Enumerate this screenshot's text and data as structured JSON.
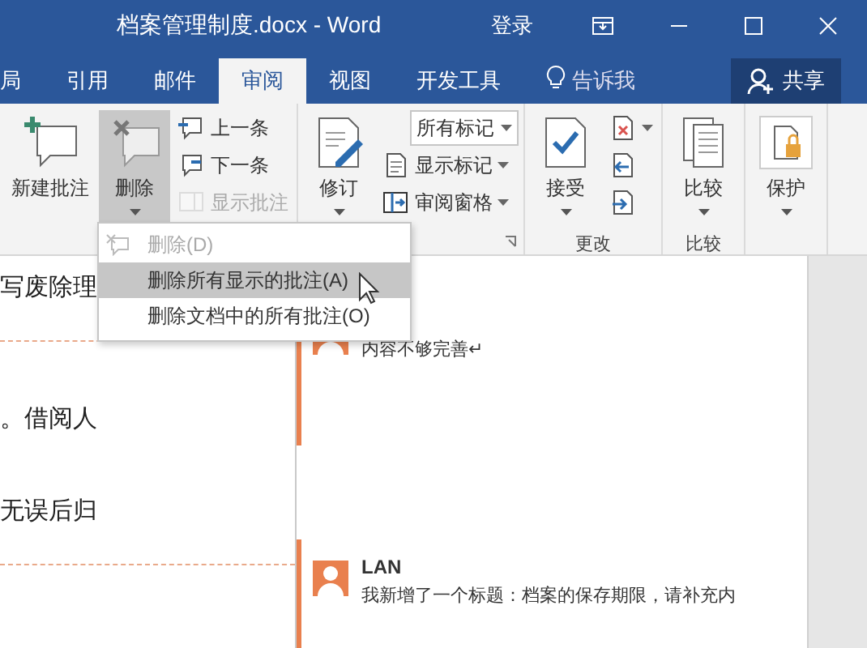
{
  "title_bar": {
    "title": "档案管理制度.docx - Word",
    "sign_in": "登录"
  },
  "tabs": [
    {
      "label": "局",
      "selected": false
    },
    {
      "label": "引用",
      "selected": false
    },
    {
      "label": "邮件",
      "selected": false
    },
    {
      "label": "审阅",
      "selected": true
    },
    {
      "label": "视图",
      "selected": false
    },
    {
      "label": "开发工具",
      "selected": false
    }
  ],
  "tell_me": "告诉我",
  "share_button": "共享",
  "ribbon": {
    "groups": [
      {
        "items": [
          {
            "kind": "large",
            "label": "新建批注",
            "pressed": false,
            "caret": false
          },
          {
            "kind": "large",
            "label": "删除",
            "pressed": true,
            "caret": true
          },
          {
            "kind": "stack",
            "rows": [
              {
                "kind": "small",
                "label": "上一条",
                "disabled": false,
                "caret": false
              },
              {
                "kind": "small",
                "label": "下一条",
                "disabled": false,
                "caret": false
              },
              {
                "kind": "small",
                "label": "显示批注",
                "disabled": true,
                "caret": false
              }
            ]
          }
        ]
      },
      {
        "items": [
          {
            "kind": "large",
            "label": "修订",
            "pressed": false,
            "caret": true
          },
          {
            "kind": "stack",
            "rows": [
              {
                "kind": "dropdown",
                "label": "所有标记",
                "caret": true
              },
              {
                "kind": "small",
                "label": "显示标记",
                "disabled": false,
                "caret": true
              },
              {
                "kind": "small",
                "label": "审阅窗格",
                "disabled": false,
                "caret": true
              }
            ]
          }
        ],
        "launcher": true
      },
      {
        "label": "更改",
        "items": [
          {
            "kind": "large",
            "label": "接受",
            "pressed": false,
            "caret": true
          },
          {
            "kind": "stack",
            "rows": [
              {
                "kind": "icon",
                "disabled": false,
                "caret": true
              },
              {
                "kind": "icon",
                "disabled": false,
                "caret": false
              },
              {
                "kind": "icon",
                "disabled": false,
                "caret": false
              }
            ]
          }
        ]
      },
      {
        "label": "比较",
        "items": [
          {
            "kind": "large",
            "label": "比较",
            "pressed": false,
            "caret": true
          }
        ]
      },
      {
        "items": [
          {
            "kind": "large",
            "label": "保护",
            "pressed": false,
            "caret": true
          }
        ]
      }
    ]
  },
  "menu": [
    {
      "label": "删除(D)",
      "disabled": true,
      "selected": false
    },
    {
      "label": "删除所有显示的批注(A)",
      "disabled": false,
      "selected": true
    },
    {
      "label": "删除文档中的所有批注(O)",
      "disabled": false,
      "selected": false
    }
  ],
  "document_lines": [
    "写废除理",
    "。借阅人",
    "无误后归"
  ],
  "comments": [
    {
      "text": "内容不够完善↵"
    },
    {
      "author": "LAN",
      "text": "我新增了一个标题：档案的保存期限，请补充内"
    }
  ]
}
